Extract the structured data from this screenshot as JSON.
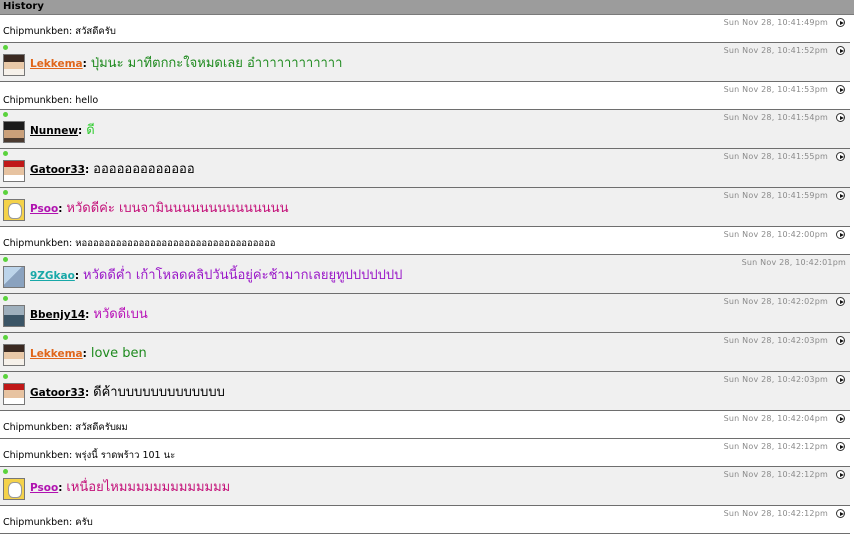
{
  "window": {
    "title": "History"
  },
  "colors": {
    "titlebar": "#9c9c9c",
    "timestamp": "#8a8a8a",
    "online_dot": "#5ad23c",
    "row_alt": "#f0f0f0",
    "Lekkema": "#e0661a",
    "Lekkema_text": "#1e8a1e",
    "Nunnew_text": "#2ecc2e",
    "Psoo": "#b012b0",
    "Psoo_text": "#c4127a",
    "9ZGkao": "#18a8a8",
    "9ZGkao_text": "#9a18c8",
    "Bbenjy14_text": "#b812b8"
  },
  "icons": {
    "status": "online-dot-icon",
    "replay": "play-circle-icon"
  },
  "messages": [
    {
      "kind": "plain",
      "user": "Chipmunkben",
      "text": "สวัสดีครับ",
      "time": "Sun Nov 28, 10:41:49pm"
    },
    {
      "kind": "rich",
      "user": "Lekkema",
      "text": "ปุ่มนะ มาทีตกกะใจหมดเลย อ๋าาาาาาาาาาาา",
      "time": "Sun Nov 28, 10:41:52pm",
      "avatar": "lek",
      "name_color": "#e0661a",
      "text_color": "#1e8a1e"
    },
    {
      "kind": "plain",
      "user": "Chipmunkben",
      "text": "hello",
      "time": "Sun Nov 28, 10:41:53pm"
    },
    {
      "kind": "rich",
      "user": "Nunnew",
      "text": "ดี",
      "time": "Sun Nov 28, 10:41:54pm",
      "avatar": "nun",
      "name_color": "#000000",
      "text_color": "#2ecc2e"
    },
    {
      "kind": "rich",
      "user": "Gatoor33",
      "text": "อออออออออออออ",
      "time": "Sun Nov 28, 10:41:55pm",
      "avatar": "gat",
      "name_color": "#000000",
      "text_color": "#000000"
    },
    {
      "kind": "rich",
      "user": "Psoo",
      "text": "หวัดดีค่ะ เบนจามินนนนนนนนนนนนนน",
      "time": "Sun Nov 28, 10:41:59pm",
      "avatar": "pso",
      "name_color": "#b012b0",
      "text_color": "#c4127a"
    },
    {
      "kind": "plain",
      "user": "Chipmunkben",
      "text": "หออออออออออออออออออออออออออออออออออ",
      "time": "Sun Nov 28, 10:42:00pm"
    },
    {
      "kind": "rich",
      "user": "9ZGkao",
      "text": "หวัดดีค่ำ เก้าโหลดคลิปวันนี้อยู่ค่ะช้ามากเลยยูทูปปปปปปป",
      "time": "Sun Nov 28, 10:42:01pm",
      "avatar": "9zg",
      "name_color": "#18a8a8",
      "text_color": "#9a18c8",
      "no_icon": true
    },
    {
      "kind": "rich",
      "user": "Bbenjy14",
      "text": "หวัดดีเบน",
      "time": "Sun Nov 28, 10:42:02pm",
      "avatar": "bbe",
      "name_color": "#000000",
      "text_color": "#b812b8"
    },
    {
      "kind": "rich",
      "user": "Lekkema",
      "text": "love ben",
      "time": "Sun Nov 28, 10:42:03pm",
      "avatar": "lek",
      "name_color": "#e0661a",
      "text_color": "#1e8a1e"
    },
    {
      "kind": "rich",
      "user": "Gatoor33",
      "text": "ดีค้าบบบบบบบบบบบบบ",
      "time": "Sun Nov 28, 10:42:03pm",
      "avatar": "gat",
      "name_color": "#000000",
      "text_color": "#000000"
    },
    {
      "kind": "plain",
      "user": "Chipmunkben",
      "text": "สวัสดีครับผม",
      "time": "Sun Nov 28, 10:42:04pm"
    },
    {
      "kind": "plain",
      "user": "Chipmunkben",
      "text": "พรุ่งนี้ ราดพร้าว 101 นะ",
      "time": "Sun Nov 28, 10:42:12pm"
    },
    {
      "kind": "rich",
      "user": "Psoo",
      "text": "เหนื่อยไหมมมมมมมมมมมมม",
      "time": "Sun Nov 28, 10:42:12pm",
      "avatar": "pso",
      "name_color": "#b012b0",
      "text_color": "#c4127a"
    },
    {
      "kind": "plain",
      "user": "Chipmunkben",
      "text": "ครับ",
      "time": "Sun Nov 28, 10:42:12pm"
    }
  ]
}
